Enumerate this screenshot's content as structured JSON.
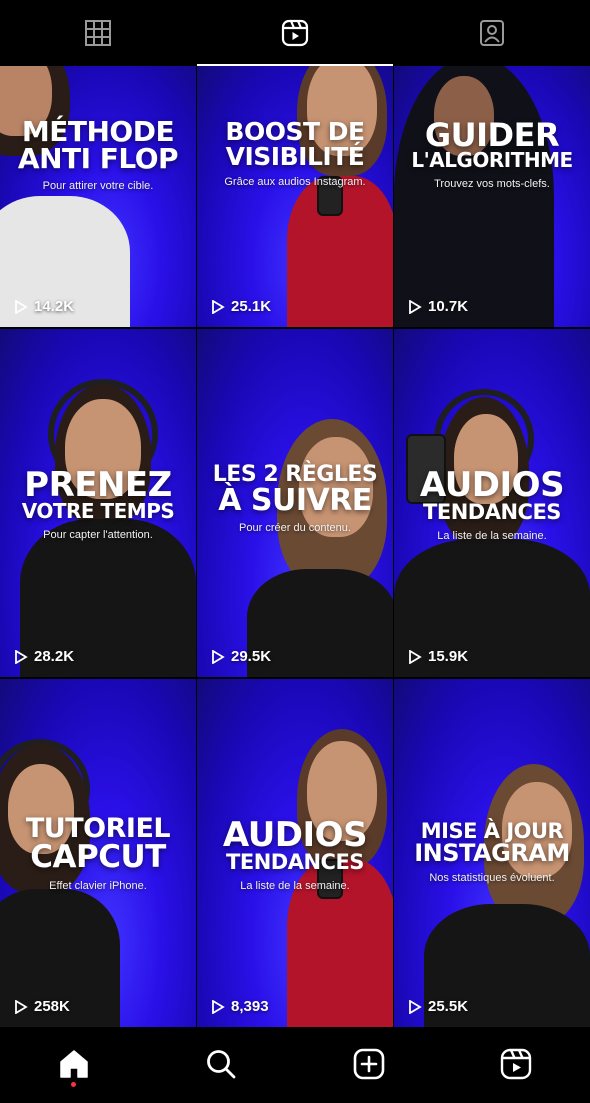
{
  "profile_tabs": [
    {
      "name": "grid",
      "icon": "grid-icon",
      "active": false
    },
    {
      "name": "reels",
      "icon": "reels-icon",
      "active": true
    },
    {
      "name": "tagged",
      "icon": "tagged-icon",
      "active": false
    }
  ],
  "posts": [
    {
      "title_lines": [
        "MÉTHODE",
        "ANTI FLOP"
      ],
      "subtitle": "Pour attirer votre cible.",
      "views": "14.2K"
    },
    {
      "title_lines": [
        "BOOST DE",
        "VISIBILITÉ"
      ],
      "subtitle": "Grâce aux audios Instagram.",
      "views": "25.1K"
    },
    {
      "title_lines": [
        "GUIDER",
        "L'ALGORITHME"
      ],
      "subtitle": "Trouvez vos mots-clefs.",
      "views": "10.7K"
    },
    {
      "title_lines": [
        "PRENEZ",
        "VOTRE TEMPS"
      ],
      "subtitle": "Pour capter l'attention.",
      "views": "28.2K"
    },
    {
      "title_lines": [
        "LES 2 RÈGLES",
        "À SUIVRE"
      ],
      "subtitle": "Pour créer du contenu.",
      "views": "29.5K"
    },
    {
      "title_lines": [
        "AUDIOS",
        "TENDANCES"
      ],
      "subtitle": "La liste de la semaine.",
      "views": "15.9K"
    },
    {
      "title_lines": [
        "TUTORIEL",
        "CAPCUT"
      ],
      "subtitle": "Effet clavier iPhone.",
      "views": "258K"
    },
    {
      "title_lines": [
        "AUDIOS",
        "TENDANCES"
      ],
      "subtitle": "La liste de la semaine.",
      "views": "8,393"
    },
    {
      "title_lines": [
        "MISE À JOUR",
        "INSTAGRAM"
      ],
      "subtitle": "Nos statistiques évoluent.",
      "views": "25.5K"
    }
  ],
  "bottom_nav": [
    {
      "name": "home",
      "icon": "home-icon",
      "active": true,
      "notification_dot": true
    },
    {
      "name": "search",
      "icon": "search-icon",
      "active": false
    },
    {
      "name": "create",
      "icon": "plus-square-icon",
      "active": false
    },
    {
      "name": "reels",
      "icon": "reels-icon",
      "active": false
    }
  ],
  "colors": {
    "tile_blue": "#2a10e8",
    "background": "#000000",
    "notification_dot": "#ff3040"
  }
}
